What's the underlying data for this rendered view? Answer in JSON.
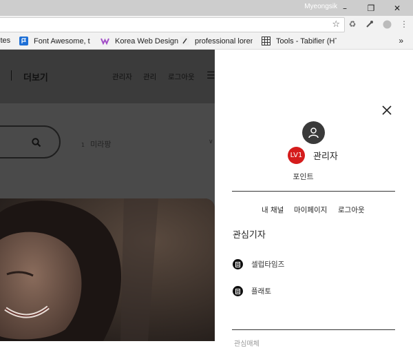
{
  "browser": {
    "user_name": "Myeongsik",
    "window_controls": {
      "minimize": "–",
      "maximize": "❐",
      "close": "✕"
    },
    "bookmarks": [
      {
        "label": "ites",
        "icon": "none"
      },
      {
        "label": "Font Awesome, the",
        "icon": "flag-icon"
      },
      {
        "label": "Korea Web Design",
        "icon": "w-logo-icon"
      },
      {
        "label": "professional lorem i",
        "icon": "lorem-icon"
      },
      {
        "label": "Tools - Tabifier (HT",
        "icon": "grid-icon"
      }
    ],
    "bookmarks_more": "»"
  },
  "page": {
    "header": {
      "more_label": "더보기",
      "admin_label": "관리자",
      "manage_label": "관리",
      "logout_label": "로그아웃"
    },
    "region": {
      "prefix": "1",
      "label": "미라팡",
      "chevron": "∨"
    }
  },
  "panel": {
    "level_badge": "LV1",
    "user_label": "관리자",
    "points_label": "포인트",
    "links": {
      "my_channel": "내 채널",
      "my_page": "마이페이지",
      "logout": "로그아웃"
    },
    "section_title": "관심기자",
    "favorites": [
      {
        "label": "셀럽타임즈",
        "icon": "media-icon"
      },
      {
        "label": "플래토",
        "icon": "media-icon"
      }
    ],
    "cut_text": "관심매체"
  },
  "colors": {
    "badge_red": "#d51c1c",
    "overlay": "#4a4a4a",
    "panel_bg": "#ffffff"
  }
}
